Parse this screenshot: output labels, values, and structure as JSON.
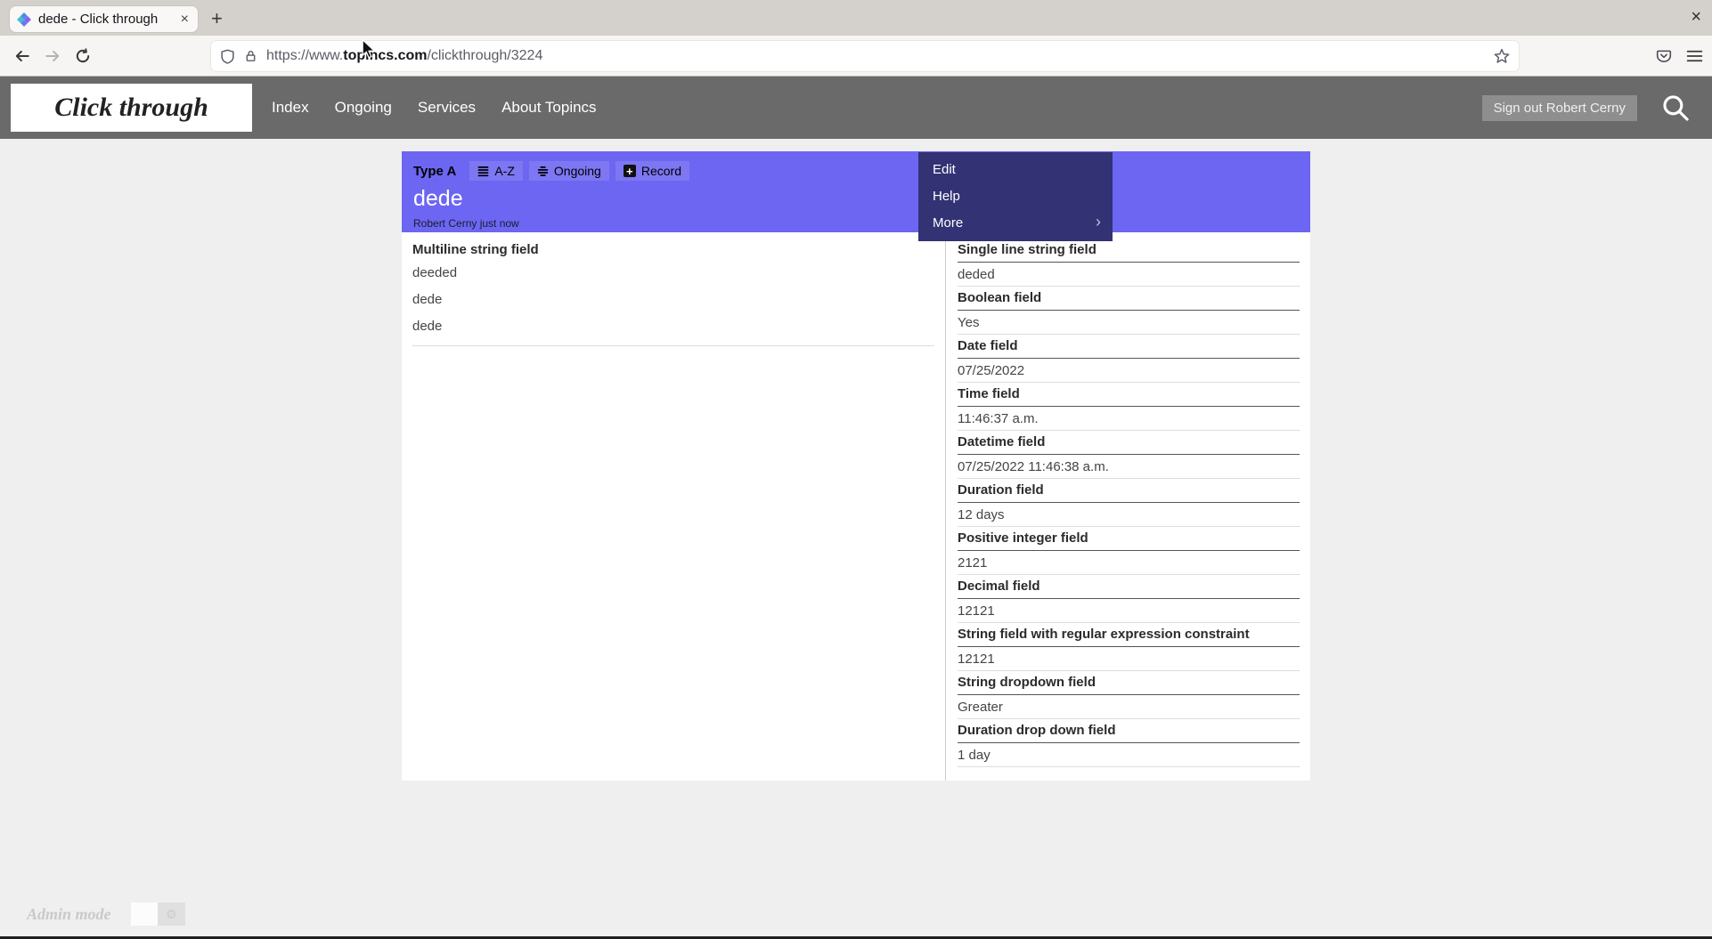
{
  "browser": {
    "tab_title": "dede - Click through",
    "url_prefix": "https://www.",
    "url_domain": "topincs.com",
    "url_path": "/clickthrough/3224"
  },
  "icons": {
    "close_glyph": "×",
    "new_tab_glyph": "+",
    "plus_glyph": "+",
    "more_chevron": "›",
    "gear_glyph": "⚙"
  },
  "site_nav": {
    "logo": "Click through",
    "links": [
      "Index",
      "Ongoing",
      "Services",
      "About Topincs"
    ],
    "sign_out_label": "Sign out Robert Cerny"
  },
  "card": {
    "type_label": "Type A",
    "buttons": {
      "az": "A-Z",
      "ongoing": "Ongoing",
      "record": "Record"
    },
    "title": "dede",
    "byline": "Robert Cerny just now",
    "multiline_field": {
      "label": "Multiline string field",
      "values": [
        "deeded",
        "dede",
        "dede"
      ]
    },
    "fields": [
      {
        "label": "Single line string field",
        "value": "deded"
      },
      {
        "label": "Boolean field",
        "value": "Yes"
      },
      {
        "label": "Date field",
        "value": "07/25/2022"
      },
      {
        "label": "Time field",
        "value": "11:46:37 a.m."
      },
      {
        "label": "Datetime field",
        "value": "07/25/2022 11:46:38 a.m."
      },
      {
        "label": "Duration field",
        "value": "12 days"
      },
      {
        "label": "Positive integer field",
        "value": "2121"
      },
      {
        "label": "Decimal field",
        "value": "12121"
      },
      {
        "label": "String field with regular expression constraint",
        "value": "12121"
      },
      {
        "label": "String dropdown field",
        "value": "Greater"
      },
      {
        "label": "Duration drop down field",
        "value": "1 day"
      }
    ]
  },
  "context_menu": {
    "edit": "Edit",
    "help": "Help",
    "more": "More"
  },
  "footer": {
    "admin_mode_label": "Admin mode"
  },
  "colors": {
    "accent_purple": "#6d66f2",
    "button_purple": "#7d77f3",
    "menu_indigo": "#323274",
    "nav_gray": "#6a6a6a",
    "page_bg": "#efefef"
  }
}
